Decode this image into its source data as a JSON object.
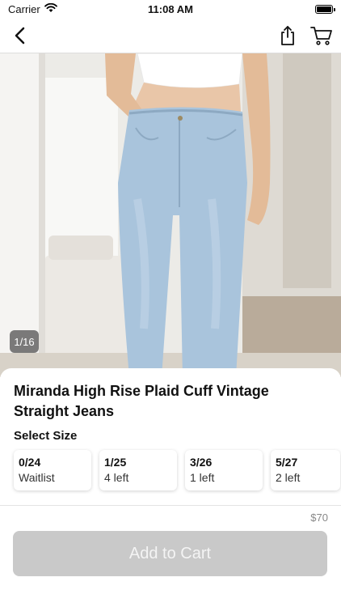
{
  "status_bar": {
    "carrier": "Carrier",
    "time": "11:08 AM"
  },
  "nav": {
    "back_icon": "chevron-left-icon",
    "share_icon": "share-icon",
    "cart_icon": "cart-icon"
  },
  "product": {
    "image_counter": "1/16",
    "title": "Miranda High Rise Plaid Cuff Vintage Straight Jeans",
    "select_size_label": "Select Size",
    "sizes": [
      {
        "size": "0/24",
        "stock": "Waitlist"
      },
      {
        "size": "1/25",
        "stock": "4 left"
      },
      {
        "size": "3/26",
        "stock": "1 left"
      },
      {
        "size": "5/27",
        "stock": "2 left"
      }
    ],
    "price": "$70",
    "add_to_cart_label": "Add to Cart"
  },
  "colors": {
    "button_disabled": "#c9c9c9",
    "denim": "#a9c4dc"
  }
}
